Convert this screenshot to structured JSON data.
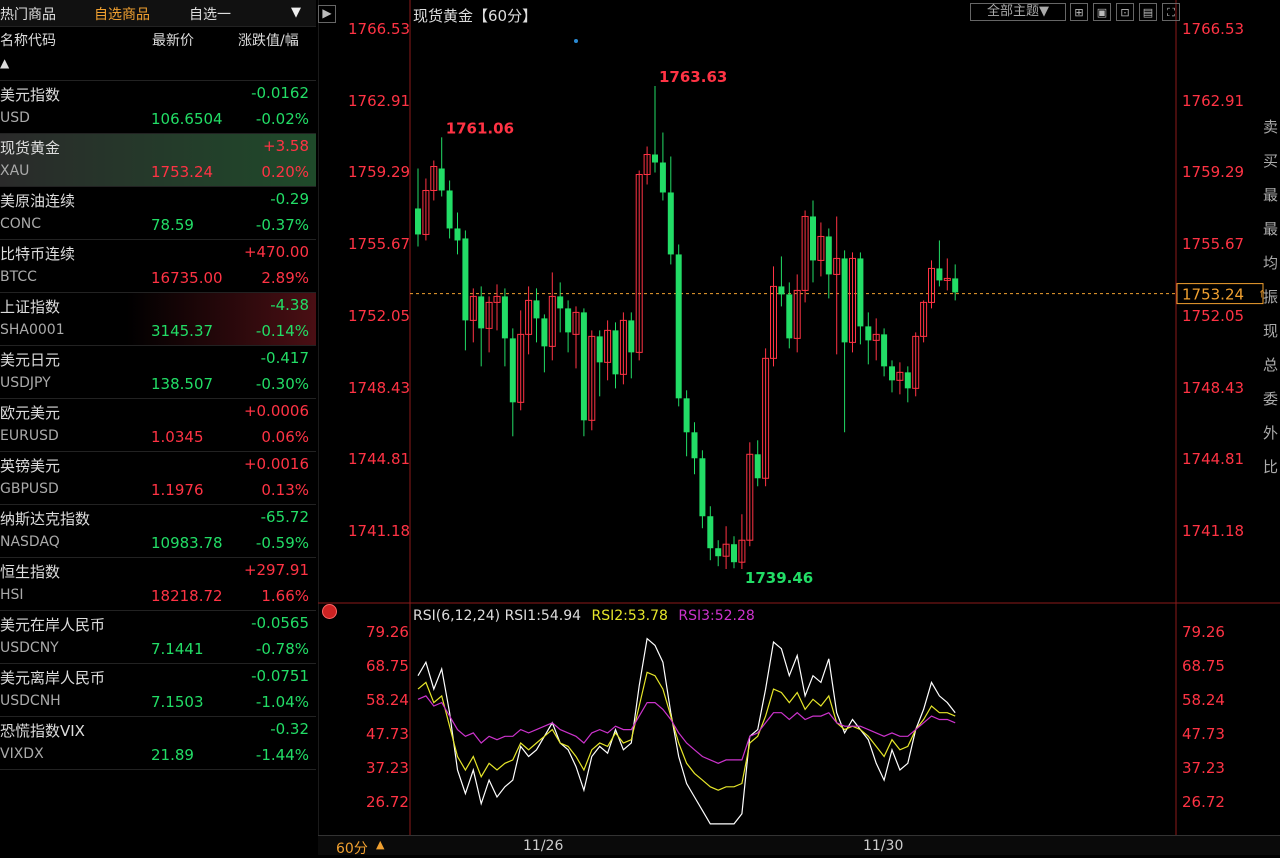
{
  "left_panel": {
    "tabs": [
      "热门商品",
      "自选商品",
      "自选一"
    ],
    "dropdown_arrow": "▼",
    "headers": {
      "name": "名称代码",
      "price": "最新价",
      "change": "涨跌值/幅"
    },
    "collapse_arrow": "▲",
    "rows": [
      {
        "name": "美元指数",
        "code": "USD",
        "price": "106.6504",
        "change": "-0.0162",
        "pct": "-0.02%",
        "dir": "down"
      },
      {
        "name": "现货黄金",
        "code": "XAU",
        "price": "1753.24",
        "change": "+3.58",
        "pct": "0.20%",
        "dir": "up"
      },
      {
        "name": "美原油连续",
        "code": "CONC",
        "price": "78.59",
        "change": "-0.29",
        "pct": "-0.37%",
        "dir": "down"
      },
      {
        "name": "比特币连续",
        "code": "BTCC",
        "price": "16735.00",
        "change": "+470.00",
        "pct": "2.89%",
        "dir": "up"
      },
      {
        "name": "上证指数",
        "code": "SHA0001",
        "price": "3145.37",
        "change": "-4.38",
        "pct": "-0.14%",
        "dir": "down"
      },
      {
        "name": "美元日元",
        "code": "USDJPY",
        "price": "138.507",
        "change": "-0.417",
        "pct": "-0.30%",
        "dir": "down"
      },
      {
        "name": "欧元美元",
        "code": "EURUSD",
        "price": "1.0345",
        "change": "+0.0006",
        "pct": "0.06%",
        "dir": "up"
      },
      {
        "name": "英镑美元",
        "code": "GBPUSD",
        "price": "1.1976",
        "change": "+0.0016",
        "pct": "0.13%",
        "dir": "up"
      },
      {
        "name": "纳斯达克指数",
        "code": "NASDAQ",
        "price": "10983.78",
        "change": "-65.72",
        "pct": "-0.59%",
        "dir": "down"
      },
      {
        "name": "恒生指数",
        "code": "HSI",
        "price": "18218.72",
        "change": "+297.91",
        "pct": "1.66%",
        "dir": "up"
      },
      {
        "name": "美元在岸人民币",
        "code": "USDCNY",
        "price": "7.1441",
        "change": "-0.0565",
        "pct": "-0.78%",
        "dir": "down"
      },
      {
        "name": "美元离岸人民币",
        "code": "USDCNH",
        "price": "7.1503",
        "change": "-0.0751",
        "pct": "-1.04%",
        "dir": "down"
      },
      {
        "name": "恐慌指数VIX",
        "code": "VIXDX",
        "price": "21.89",
        "change": "-0.32",
        "pct": "-1.44%",
        "dir": "down"
      }
    ]
  },
  "chart": {
    "title": "现货黄金【60分】",
    "theme_button": "全部主题▼",
    "period_label": "60分",
    "colors": {
      "up": "#ff3344",
      "down": "#22dd66",
      "rsi1": "#ffffff",
      "rsi2": "#e6e62a",
      "rsi3": "#cc33cc",
      "last": "#f0a030"
    }
  },
  "chart_data": {
    "type": "candlestick",
    "y_ticks": [
      "1766.53",
      "1762.91",
      "1759.29",
      "1755.67",
      "1752.05",
      "1748.43",
      "1744.81",
      "1741.18"
    ],
    "ylim": [
      1739.4,
      1766.53
    ],
    "last_price": "1753.24",
    "annotations": {
      "high1": "1761.06",
      "high2": "1763.63",
      "low": "1739.46"
    },
    "x_labels": [
      "11/26",
      "11/30"
    ],
    "candles": [
      [
        1757.5,
        1756.2,
        1759.5,
        1755.6
      ],
      [
        1756.2,
        1758.4,
        1759.0,
        1755.9
      ],
      [
        1758.4,
        1759.6,
        1759.9,
        1757.9
      ],
      [
        1759.5,
        1758.4,
        1761.06,
        1758.1
      ],
      [
        1758.4,
        1756.5,
        1758.9,
        1756.0
      ],
      [
        1756.5,
        1755.9,
        1757.3,
        1755.2
      ],
      [
        1756.0,
        1751.9,
        1756.4,
        1750.4
      ],
      [
        1751.9,
        1753.1,
        1753.5,
        1750.8
      ],
      [
        1753.1,
        1751.5,
        1753.6,
        1749.6
      ],
      [
        1751.5,
        1752.8,
        1753.1,
        1750.3
      ],
      [
        1752.8,
        1753.1,
        1753.7,
        1751.4
      ],
      [
        1753.1,
        1751.0,
        1753.5,
        1749.6
      ],
      [
        1751.0,
        1747.8,
        1751.5,
        1746.1
      ],
      [
        1747.8,
        1751.2,
        1752.4,
        1747.4
      ],
      [
        1751.2,
        1752.9,
        1753.6,
        1750.2
      ],
      [
        1752.9,
        1752.0,
        1753.5,
        1750.8
      ],
      [
        1752.0,
        1750.6,
        1752.2,
        1749.3
      ],
      [
        1750.6,
        1753.1,
        1754.3,
        1749.9
      ],
      [
        1753.1,
        1752.5,
        1753.8,
        1751.3
      ],
      [
        1752.5,
        1751.3,
        1752.9,
        1750.3
      ],
      [
        1751.2,
        1752.3,
        1752.6,
        1749.5
      ],
      [
        1752.3,
        1746.9,
        1752.5,
        1746.1
      ],
      [
        1746.9,
        1751.1,
        1751.4,
        1746.4
      ],
      [
        1751.1,
        1749.8,
        1751.4,
        1748.1
      ],
      [
        1749.8,
        1751.4,
        1751.9,
        1748.9
      ],
      [
        1751.4,
        1749.2,
        1751.8,
        1748.5
      ],
      [
        1749.2,
        1751.9,
        1752.3,
        1748.7
      ],
      [
        1751.9,
        1750.3,
        1752.3,
        1749.0
      ],
      [
        1750.3,
        1759.2,
        1759.4,
        1749.9
      ],
      [
        1759.2,
        1760.2,
        1760.6,
        1758.7
      ],
      [
        1760.2,
        1759.8,
        1763.63,
        1759.3
      ],
      [
        1759.8,
        1758.3,
        1761.3,
        1757.9
      ],
      [
        1758.3,
        1755.2,
        1760.1,
        1754.7
      ],
      [
        1755.2,
        1748.0,
        1755.7,
        1747.6
      ],
      [
        1748.0,
        1746.3,
        1748.4,
        1745.1
      ],
      [
        1746.3,
        1745.0,
        1746.8,
        1744.2
      ],
      [
        1745.0,
        1742.1,
        1745.4,
        1741.5
      ],
      [
        1742.1,
        1740.5,
        1742.6,
        1739.9
      ],
      [
        1740.5,
        1740.1,
        1740.9,
        1739.6
      ],
      [
        1740.1,
        1740.7,
        1741.6,
        1739.46
      ],
      [
        1740.7,
        1739.8,
        1741.1,
        1739.5
      ],
      [
        1739.8,
        1740.9,
        1742.2,
        1739.46
      ],
      [
        1740.9,
        1745.2,
        1745.8,
        1740.6
      ],
      [
        1745.2,
        1744.0,
        1745.9,
        1743.6
      ],
      [
        1744.0,
        1750.0,
        1750.5,
        1743.6
      ],
      [
        1750.0,
        1753.6,
        1754.6,
        1749.6
      ],
      [
        1753.6,
        1753.2,
        1755.1,
        1752.6
      ],
      [
        1753.2,
        1751.0,
        1753.8,
        1750.5
      ],
      [
        1751.0,
        1753.4,
        1754.2,
        1750.3
      ],
      [
        1753.4,
        1757.1,
        1757.4,
        1752.8
      ],
      [
        1757.1,
        1754.9,
        1757.9,
        1753.8
      ],
      [
        1754.9,
        1756.1,
        1756.8,
        1754.1
      ],
      [
        1756.1,
        1754.2,
        1756.5,
        1753.0
      ],
      [
        1754.2,
        1755.0,
        1757.1,
        1750.2
      ],
      [
        1755.0,
        1750.8,
        1755.4,
        1746.3
      ],
      [
        1750.8,
        1755.0,
        1755.3,
        1750.3
      ],
      [
        1755.0,
        1751.6,
        1755.3,
        1750.7
      ],
      [
        1751.6,
        1750.9,
        1752.3,
        1749.7
      ],
      [
        1750.9,
        1751.2,
        1752.0,
        1749.9
      ],
      [
        1751.2,
        1749.6,
        1751.5,
        1749.1
      ],
      [
        1749.6,
        1748.9,
        1749.9,
        1748.3
      ],
      [
        1748.9,
        1749.3,
        1749.8,
        1748.2
      ],
      [
        1749.3,
        1748.5,
        1749.6,
        1747.8
      ],
      [
        1748.5,
        1751.1,
        1751.3,
        1748.1
      ],
      [
        1751.1,
        1752.8,
        1752.9,
        1750.8
      ],
      [
        1752.8,
        1754.5,
        1754.9,
        1752.5
      ],
      [
        1754.5,
        1753.9,
        1755.9,
        1753.6
      ],
      [
        1753.9,
        1754.0,
        1755.0,
        1753.4
      ],
      [
        1754.0,
        1753.3,
        1754.7,
        1752.9
      ]
    ],
    "rsi": {
      "label": "RSI(6,12,24)",
      "rsi1_label": "RSI1:54.94",
      "rsi2_label": "RSI2:53.78",
      "rsi3_label": "RSI3:52.28",
      "y_ticks": [
        "79.26",
        "68.75",
        "58.24",
        "47.73",
        "37.23",
        "26.72"
      ],
      "ylim": [
        20,
        82
      ],
      "rsi1": [
        66,
        70,
        62,
        68,
        55,
        38,
        31,
        38,
        28,
        35,
        30,
        33,
        35,
        45,
        42,
        44,
        48,
        52,
        46,
        44,
        39,
        32,
        42,
        45,
        43,
        50,
        44,
        46,
        63,
        77,
        75,
        70,
        55,
        42,
        34,
        30,
        26,
        22,
        22,
        22,
        22,
        25,
        48,
        50,
        62,
        76,
        74,
        66,
        72,
        60,
        66,
        64,
        71,
        55,
        49,
        53,
        50,
        47,
        40,
        35,
        44,
        38,
        40,
        50,
        56,
        64,
        60,
        58,
        55
      ],
      "rsi2": [
        62,
        64,
        58,
        60,
        51,
        42,
        38,
        42,
        36,
        40,
        38,
        40,
        41,
        46,
        44,
        46,
        48,
        50,
        46,
        45,
        42,
        38,
        44,
        46,
        45,
        49,
        46,
        47,
        57,
        67,
        66,
        62,
        54,
        46,
        40,
        37,
        35,
        33,
        32,
        33,
        33,
        34,
        46,
        48,
        54,
        62,
        61,
        58,
        61,
        56,
        59,
        57,
        60,
        52,
        50,
        51,
        50,
        48,
        45,
        42,
        47,
        44,
        45,
        50,
        53,
        57,
        55,
        55,
        54
      ],
      "rsi3": [
        59,
        60,
        57,
        58,
        54,
        50,
        48,
        49,
        46,
        48,
        47,
        48,
        48,
        50,
        49,
        50,
        51,
        52,
        50,
        49,
        48,
        46,
        49,
        50,
        49,
        51,
        50,
        50,
        54,
        58,
        58,
        56,
        53,
        49,
        46,
        44,
        42,
        41,
        40,
        41,
        41,
        41,
        48,
        49,
        52,
        55,
        55,
        53,
        55,
        53,
        54,
        54,
        55,
        52,
        51,
        51,
        51,
        50,
        49,
        48,
        49,
        48,
        48,
        50,
        52,
        54,
        53,
        53,
        52
      ]
    }
  }
}
